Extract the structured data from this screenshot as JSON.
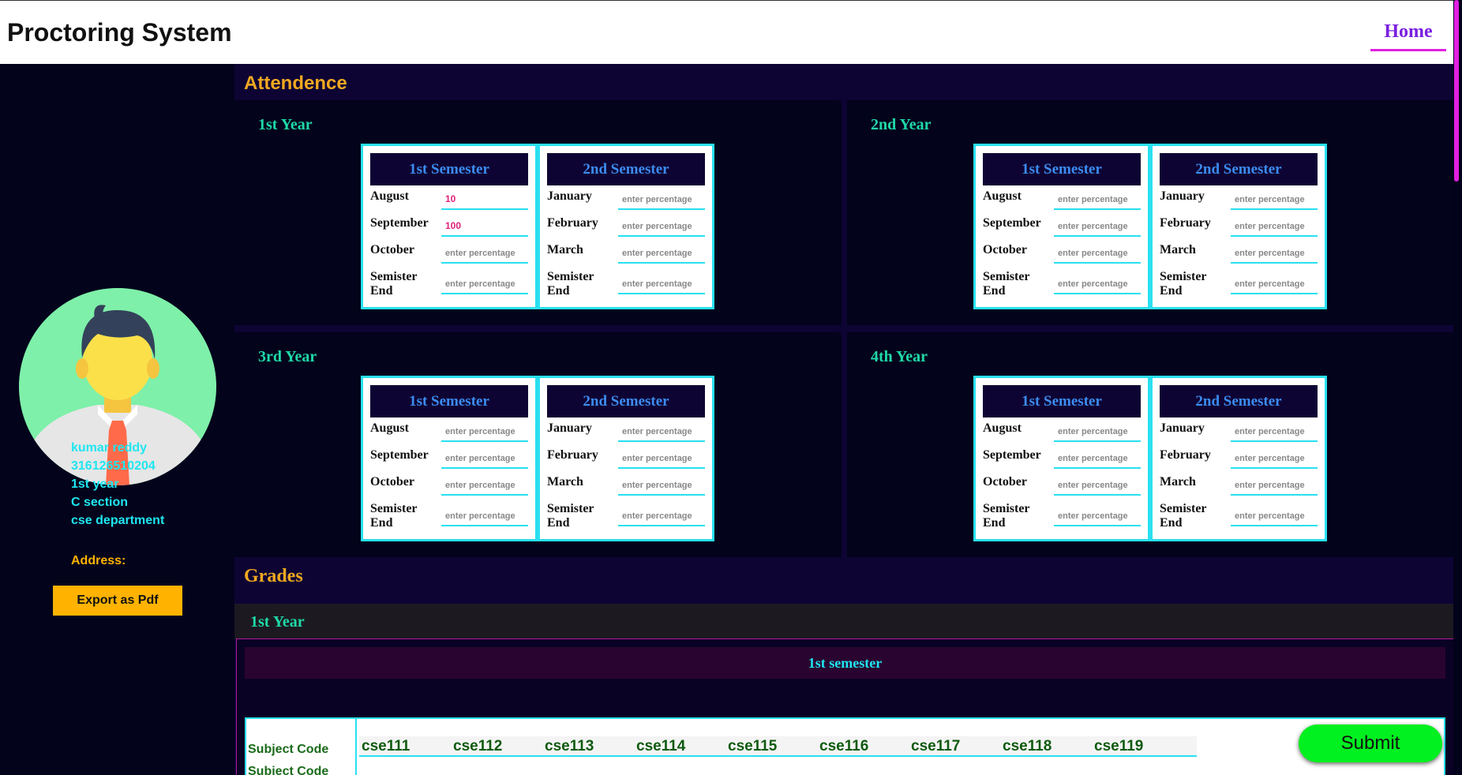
{
  "header": {
    "title": "Proctoring System",
    "home_label": "Home"
  },
  "profile": {
    "name": "kumar reddy",
    "roll_no": "316126510204",
    "year": "1st year",
    "section": "C section",
    "department": "cse department",
    "address_label": "Address:",
    "export_label": "Export as Pdf"
  },
  "attendance": {
    "title": "Attendence",
    "placeholder": "enter percentage",
    "years": [
      {
        "label": "1st Year",
        "sem1": {
          "title": "1st Semester",
          "months": [
            "August",
            "September",
            "October",
            "Semister End"
          ],
          "values": [
            "10",
            "100",
            "",
            ""
          ]
        },
        "sem2": {
          "title": "2nd Semester",
          "months": [
            "January",
            "February",
            "March",
            "Semister End"
          ],
          "values": [
            "",
            "",
            "",
            ""
          ]
        }
      },
      {
        "label": "2nd Year",
        "sem1": {
          "title": "1st Semester",
          "months": [
            "August",
            "September",
            "October",
            "Semister End"
          ],
          "values": [
            "",
            "",
            "",
            ""
          ]
        },
        "sem2": {
          "title": "2nd Semester",
          "months": [
            "January",
            "February",
            "March",
            "Semister End"
          ],
          "values": [
            "",
            "",
            "",
            ""
          ]
        }
      },
      {
        "label": "3rd Year",
        "sem1": {
          "title": "1st Semester",
          "months": [
            "August",
            "September",
            "October",
            "Semister End"
          ],
          "values": [
            "",
            "",
            "",
            ""
          ]
        },
        "sem2": {
          "title": "2nd Semester",
          "months": [
            "January",
            "February",
            "March",
            "Semister End"
          ],
          "values": [
            "",
            "",
            "",
            ""
          ]
        }
      },
      {
        "label": "4th Year",
        "sem1": {
          "title": "1st Semester",
          "months": [
            "August",
            "September",
            "October",
            "Semister End"
          ],
          "values": [
            "",
            "",
            "",
            ""
          ]
        },
        "sem2": {
          "title": "2nd Semester",
          "months": [
            "January",
            "February",
            "March",
            "Semister End"
          ],
          "values": [
            "",
            "",
            "",
            ""
          ]
        }
      }
    ]
  },
  "grades": {
    "title": "Grades",
    "year_label": "1st Year",
    "semester_label": "1st semester",
    "subject_code_label": "Subject Code",
    "subject_codes": [
      "cse111",
      "cse112",
      "cse113",
      "cse114",
      "cse115",
      "cse116",
      "cse117",
      "cse118",
      "cse119"
    ]
  },
  "submit_label": "Submit",
  "colors": {
    "accent": "#1fe6f0",
    "highlight": "#ffb300",
    "brand": "#7a1fe0",
    "submit": "#00f020"
  }
}
